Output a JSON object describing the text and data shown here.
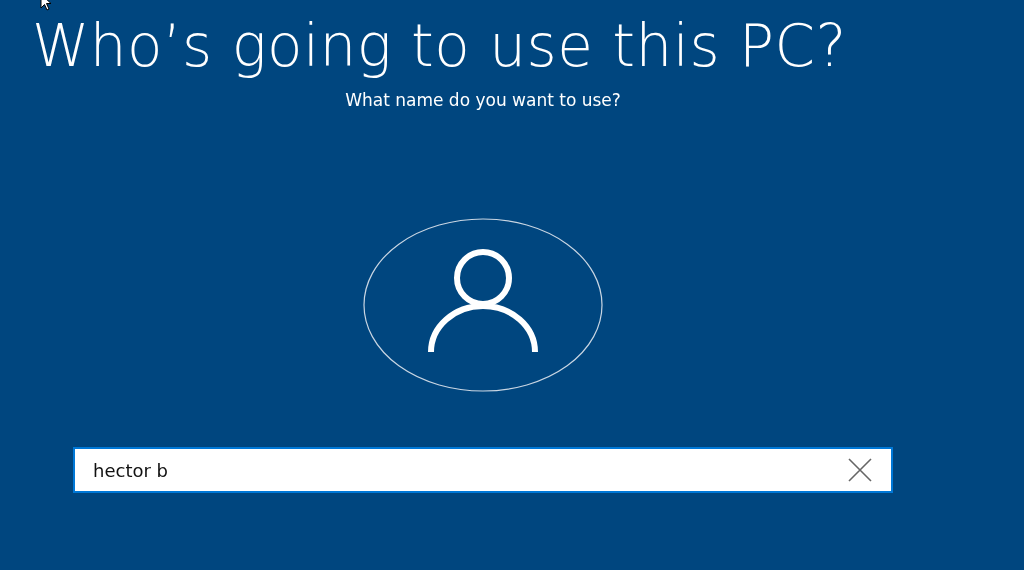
{
  "title": "Who’s going to use this PC?",
  "subtitle": "What name do you want to use?",
  "name_field": {
    "value": "hector b"
  }
}
